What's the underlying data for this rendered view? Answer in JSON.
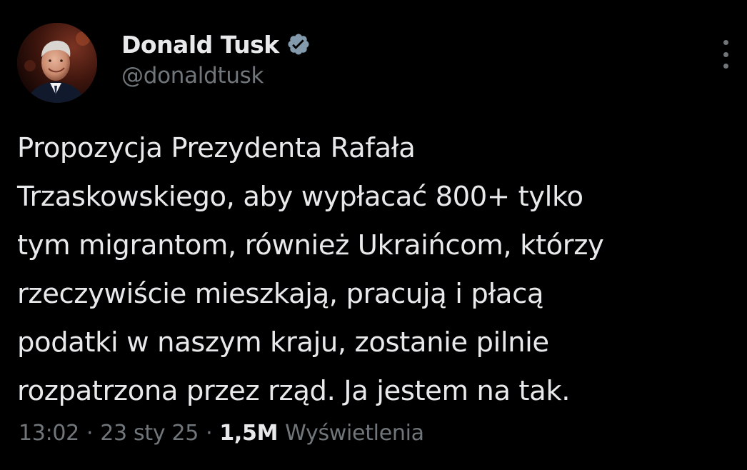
{
  "tweet": {
    "author": {
      "display_name": "Donald Tusk",
      "handle": "@donaldtusk",
      "verified_icon": "verified-badge-icon",
      "avatar": "profile-photo"
    },
    "more_icon": "more-options-icon",
    "body_lines": [
      "Propozycja Prezydenta Rafała",
      "Trzaskowskiego, aby wypłacać 800+ tylko",
      "tym migrantom, również Ukraińcom, którzy",
      "rzeczywiście mieszkają, pracują i płacą",
      "podatki w naszym kraju, zostanie pilnie",
      "rozpatrzona przez rząd. Ja jestem na tak."
    ],
    "meta": {
      "time": "13:02",
      "separator": "·",
      "date": "23 sty 25",
      "views_count": "1,5M",
      "views_label": "Wyświetlenia"
    }
  },
  "colors": {
    "background": "#000000",
    "text_primary": "#e7e9ea",
    "text_secondary": "#71767b",
    "verified_badge": "#829aab"
  }
}
